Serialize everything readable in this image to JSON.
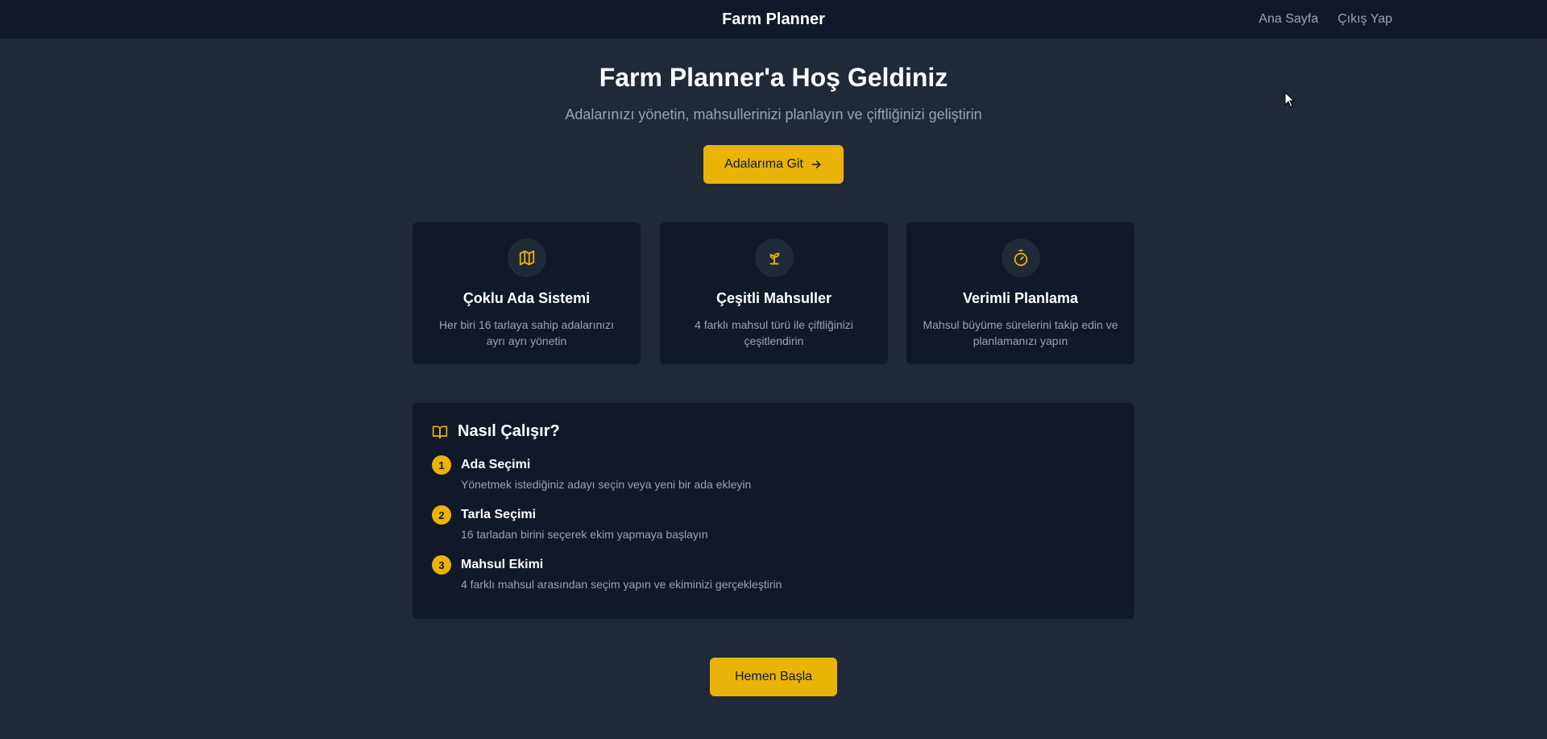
{
  "header": {
    "brand": "Farm Planner",
    "nav": [
      "Ana Sayfa",
      "Çıkış Yap"
    ]
  },
  "hero": {
    "title": "Farm Planner'a Hoş Geldiniz",
    "subtitle": "Adalarınızı yönetin, mahsullerinizi planlayın ve çiftliğinizi geliştirin",
    "cta_label": "Adalarıma Git",
    "cta_icon": "arrow-right-icon"
  },
  "features": [
    {
      "icon": "map-icon",
      "title": "Çoklu Ada Sistemi",
      "desc": "Her biri 16 tarlaya sahip adalarınızı ayrı ayrı yönetin"
    },
    {
      "icon": "sprout-icon",
      "title": "Çeşitli Mahsuller",
      "desc": "4 farklı mahsul türü ile çiftliğinizi çeşitlendirin"
    },
    {
      "icon": "timer-icon",
      "title": "Verimli Planlama",
      "desc": "Mahsul büyüme sürelerini takip edin ve planlamanızı yapın"
    }
  ],
  "how": {
    "icon": "book-open-icon",
    "title": "Nasıl Çalışır?",
    "steps": [
      {
        "num": "1",
        "title": "Ada Seçimi",
        "desc": "Yönetmek istediğiniz adayı seçin veya yeni bir ada ekleyin"
      },
      {
        "num": "2",
        "title": "Tarla Seçimi",
        "desc": "16 tarladan birini seçerek ekim yapmaya başlayın"
      },
      {
        "num": "3",
        "title": "Mahsul Ekimi",
        "desc": "4 farklı mahsul arasından seçim yapın ve ekiminizi gerçekleştirin"
      }
    ]
  },
  "footer_cta": {
    "label": "Hemen Başla"
  },
  "colors": {
    "accent": "#eab308",
    "background": "#1f2937",
    "surface": "#111827",
    "muted": "#9ca3af"
  }
}
